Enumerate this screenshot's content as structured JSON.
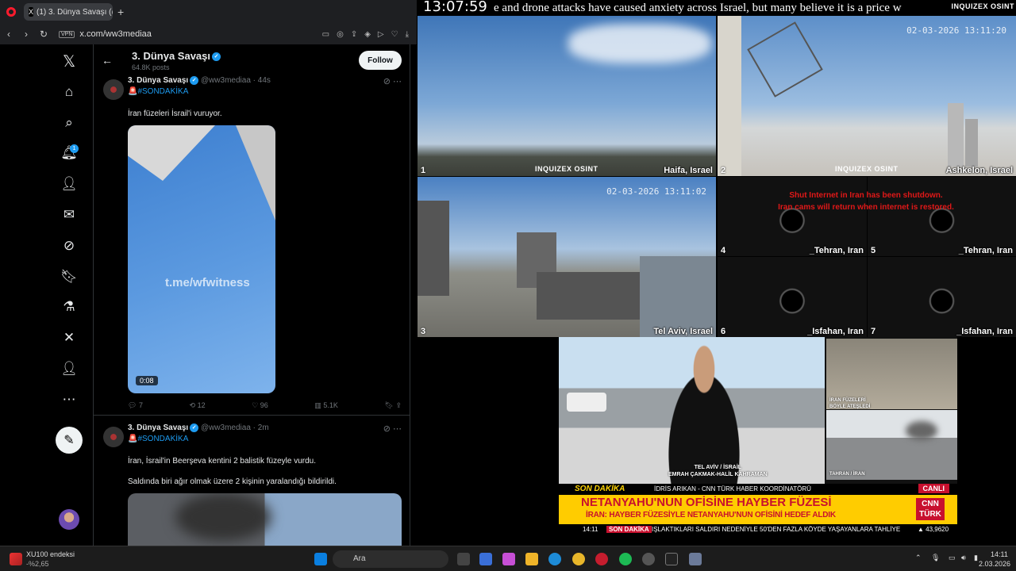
{
  "browser": {
    "tab_title": "(1) 3. Dünya Savaşı (@ww",
    "tab_x": "X",
    "new_tab": "+",
    "url": "x.com/ww3mediaa",
    "vpn": "VPN"
  },
  "xnav": {
    "logo": "𝕏",
    "notification_count": "1"
  },
  "profile": {
    "title": "3. Dünya Savaşı",
    "posts": "64.8K posts",
    "follow_label": "Follow"
  },
  "tweets": [
    {
      "name": "3. Dünya Savaşı",
      "handle": "@ww3mediaa · 44s",
      "tag": "🚨#SONDAKİKA",
      "text": "İran füzeleri İsrail'i vuruyor.",
      "watermark": "t.me/wfwitness",
      "duration": "0:08",
      "replies": "7",
      "reposts": "12",
      "likes": "96",
      "views": "5.1K"
    },
    {
      "name": "3. Dünya Savaşı",
      "handle": "@ww3mediaa · 2m",
      "tag": "🚨#SONDAKİKA",
      "text1": "İran, İsrail'in Beerşeva kentini 2 balistik füzeyle vurdu.",
      "text2": "Saldında biri ağır olmak üzere 2 kişinin yaralandığı bildirildi."
    }
  ],
  "stream": {
    "clock": "13:07:59",
    "ticker": "e and drone attacks have caused anxiety across Israel, but many believe it is a price w",
    "logo": "INQUIZEX OSINT",
    "cams": [
      {
        "num": "1",
        "label": "Haifa, Israel",
        "overlay": "INQUIZEX OSINT"
      },
      {
        "num": "2",
        "label": "Ashkelon, Israel",
        "timestamp": "02-03-2026 13:11:20",
        "overlay": "INQUIZEX OSINT"
      },
      {
        "num": "3",
        "label": "Tel Aviv, Israel",
        "timestamp": "02-03-2026 13:11:02"
      },
      {
        "num": "4",
        "label": "_Tehran, Iran"
      },
      {
        "num": "5",
        "label": "_Tehran, Iran"
      },
      {
        "num": "6",
        "label": "_Isfahan, Iran"
      },
      {
        "num": "7",
        "label": "_Isfahan, Iran"
      }
    ],
    "error_line1": "Shut Internet in Iran has been shutdown.",
    "error_line2": "Iran cams will return when internet is restored."
  },
  "news": {
    "loc_line1": "TEL AVİV / İSRAİL",
    "loc_line2": "EMRAH ÇAKMAK-HALİL KAHRAMAN",
    "inset1_line1": "İRAN FÜZELERİ",
    "inset1_line2": "BÖYLE ATEŞLEDİ",
    "inset2": "TAHRAN / İRAN",
    "son_dakika": "SON DAKİKA",
    "coordinator": "İDRİS ARIKAN - CNN TÜRK HABER KOORDİNATÖRÜ",
    "live": "CANLI",
    "headline": "NETANYAHU'NUN OFİSİNE HAYBER FÜZESİ",
    "subheadline": "İRAN: HAYBER FÜZESİYLE NETANYAHU'NUN OFİSİNİ HEDEF ALDIK",
    "logo_line1": "CNN",
    "logo_line2": "TÜRK",
    "crawl_time": "14:11",
    "crawl_tag": "SON DAKİKA",
    "crawl_text": "IŞLAKTIKLARI SALDIRI NEDENİYLE 50'DEN FAZLA KÖYDE YAŞAYANLARA TAHLİYE",
    "crawl_index": "▲ 43,9620"
  },
  "taskbar": {
    "stock_name": "XU100 endeksi",
    "stock_change": "-%2,65",
    "search": "Ara",
    "time": "14:11",
    "date": "2.03.2026"
  }
}
